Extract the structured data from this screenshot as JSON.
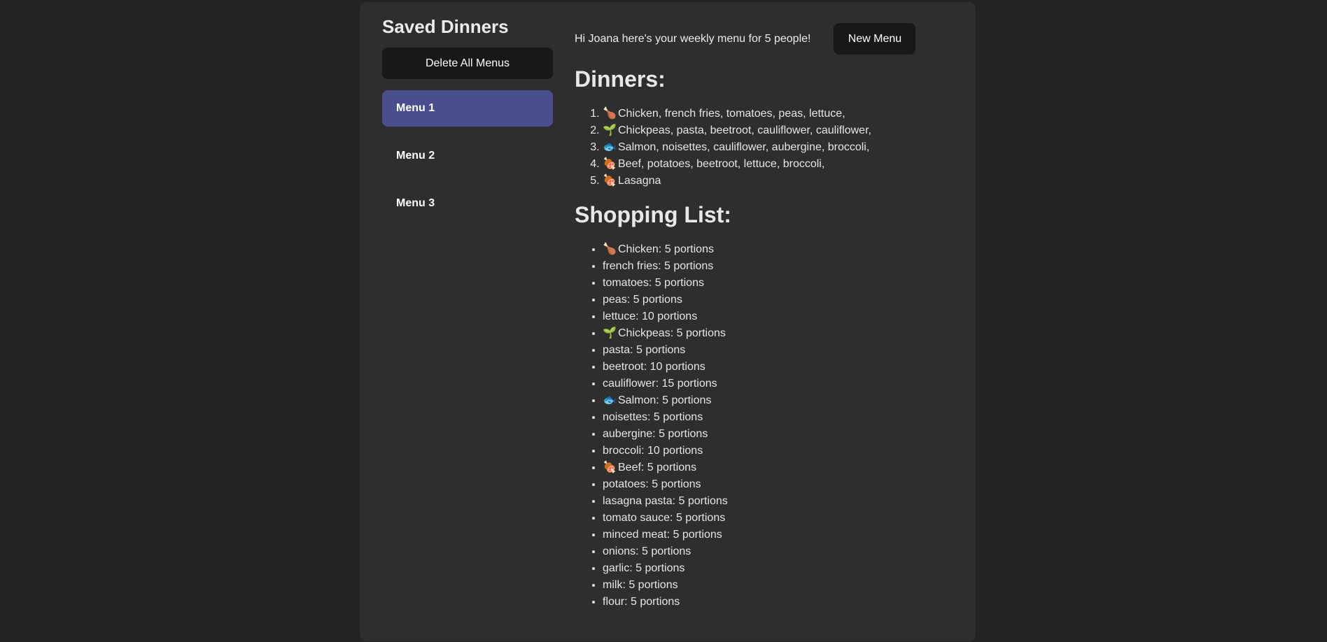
{
  "sidebar": {
    "title": "Saved Dinners",
    "delete_label": "Delete All Menus",
    "menus": [
      {
        "label": "Menu 1",
        "active": true
      },
      {
        "label": "Menu 2",
        "active": false
      },
      {
        "label": "Menu 3",
        "active": false
      }
    ]
  },
  "header": {
    "greeting": "Hi Joana here's your weekly menu for 5 people!",
    "new_menu_label": "New Menu"
  },
  "dinners": {
    "title": "Dinners:",
    "items": [
      {
        "icon": "🍗",
        "icon_name": "poultry-leg-icon",
        "text": "Chicken, french fries, tomatoes, peas, lettuce,"
      },
      {
        "icon": "🌱",
        "icon_name": "seedling-icon",
        "text": "Chickpeas, pasta, beetroot, cauliflower, cauliflower,"
      },
      {
        "icon": "🐟",
        "icon_name": "fish-icon",
        "text": "Salmon, noisettes, cauliflower, aubergine, broccoli,"
      },
      {
        "icon": "🍖",
        "icon_name": "meat-on-bone-icon",
        "text": "Beef, potatoes, beetroot, lettuce, broccoli,"
      },
      {
        "icon": "🍖",
        "icon_name": "meat-on-bone-icon",
        "text": "Lasagna"
      }
    ]
  },
  "shopping": {
    "title": "Shopping List:",
    "items": [
      {
        "icon": "🍗",
        "icon_name": "poultry-leg-icon",
        "text": "Chicken: 5 portions"
      },
      {
        "icon": "",
        "text": "french fries: 5 portions"
      },
      {
        "icon": "",
        "text": "tomatoes: 5 portions"
      },
      {
        "icon": "",
        "text": "peas: 5 portions"
      },
      {
        "icon": "",
        "text": "lettuce: 10 portions"
      },
      {
        "icon": "🌱",
        "icon_name": "seedling-icon",
        "text": "Chickpeas: 5 portions"
      },
      {
        "icon": "",
        "text": "pasta: 5 portions"
      },
      {
        "icon": "",
        "text": "beetroot: 10 portions"
      },
      {
        "icon": "",
        "text": "cauliflower: 15 portions"
      },
      {
        "icon": "🐟",
        "icon_name": "fish-icon",
        "text": "Salmon: 5 portions"
      },
      {
        "icon": "",
        "text": "noisettes: 5 portions"
      },
      {
        "icon": "",
        "text": "aubergine: 5 portions"
      },
      {
        "icon": "",
        "text": "broccoli: 10 portions"
      },
      {
        "icon": "🍖",
        "icon_name": "meat-on-bone-icon",
        "text": "Beef: 5 portions"
      },
      {
        "icon": "",
        "text": "potatoes: 5 portions"
      },
      {
        "icon": "",
        "text": "lasagna pasta: 5 portions"
      },
      {
        "icon": "",
        "text": "tomato sauce: 5 portions"
      },
      {
        "icon": "",
        "text": "minced meat: 5 portions"
      },
      {
        "icon": "",
        "text": "onions: 5 portions"
      },
      {
        "icon": "",
        "text": "garlic: 5 portions"
      },
      {
        "icon": "",
        "text": "milk: 5 portions"
      },
      {
        "icon": "",
        "text": "flour: 5 portions"
      }
    ]
  },
  "colors": {
    "background": "#232323",
    "panel": "#2e2e2e",
    "button": "#181818",
    "active_menu": "#4a4e8c"
  }
}
